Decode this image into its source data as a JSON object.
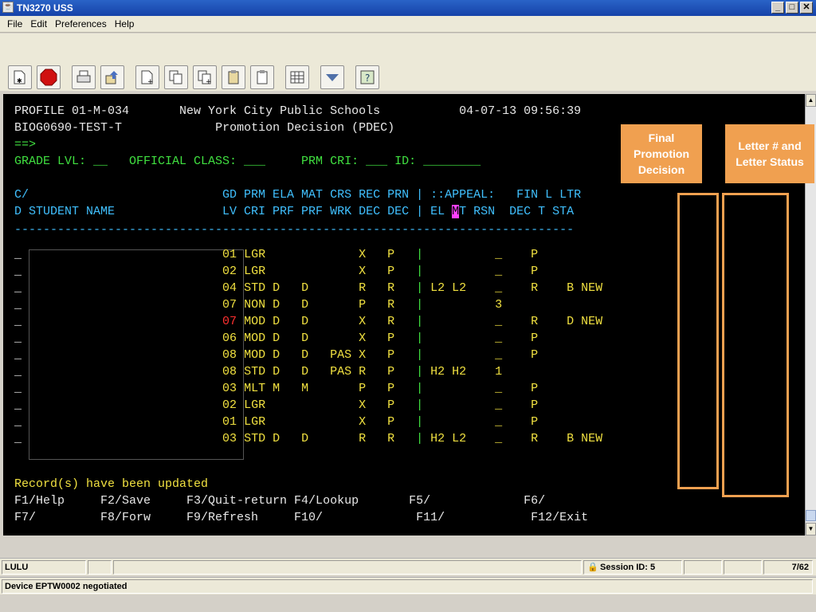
{
  "window": {
    "title": "TN3270  USS",
    "app_icon": "java-cup-icon"
  },
  "menu": [
    "File",
    "Edit",
    "Preferences",
    "Help"
  ],
  "toolbar_icons": [
    "new-session-icon",
    "stop-icon",
    "print-icon",
    "transfer-icon",
    "copy-screen-icon",
    "copy-icon",
    "copy-append-icon",
    "paste-icon",
    "paste-field-icon",
    "grid-icon",
    "dropdown-icon",
    "help-icon"
  ],
  "terminal": {
    "header1_left": "PROFILE 01-M-034",
    "header1_center": "New York City Public Schools",
    "header1_date": "04-07-13 09:56:39",
    "header2_left": "BIOG0690-TEST-T",
    "header2_center": "Promotion Decision (PDEC)",
    "command": "==>",
    "filters": "GRADE LVL: __   OFFICIAL CLASS: ___     PRM CRI: ___ ID: ________",
    "col_head1": "C/                           GD PRM ELA MAT CRS REC PRN | ::APPEAL:   FIN L LTR",
    "col_head2_a": "D STUDENT NAME               LV CRI PRF PRF WRK DEC DEC | EL ",
    "col_head2_cursor": "M",
    "col_head2_b": "T RSN  DEC T STA",
    "divider": "------------------------------------------------------------------------------",
    "rows": [
      {
        "gd": "01",
        "prm": "LGR",
        "ela": "",
        "mat": "",
        "crs": "",
        "rec": "X",
        "prn": "P",
        "el": "",
        "mt": "",
        "rsn": "_",
        "fin": "P",
        "l": "",
        "sta": "",
        "gd_red": false
      },
      {
        "gd": "02",
        "prm": "LGR",
        "ela": "",
        "mat": "",
        "crs": "",
        "rec": "X",
        "prn": "P",
        "el": "",
        "mt": "",
        "rsn": "_",
        "fin": "P",
        "l": "",
        "sta": "",
        "gd_red": false
      },
      {
        "gd": "04",
        "prm": "STD",
        "ela": "D",
        "mat": "D",
        "crs": "",
        "rec": "R",
        "prn": "R",
        "el": "L2",
        "mt": "L2",
        "rsn": "_",
        "fin": "R",
        "l": "B",
        "sta": "NEW",
        "gd_red": false
      },
      {
        "gd": "07",
        "prm": "NON",
        "ela": "D",
        "mat": "D",
        "crs": "",
        "rec": "P",
        "prn": "R",
        "el": "",
        "mt": "",
        "rsn": "3",
        "fin": "",
        "l": "",
        "sta": "",
        "gd_red": false
      },
      {
        "gd": "07",
        "prm": "MOD",
        "ela": "D",
        "mat": "D",
        "crs": "",
        "rec": "X",
        "prn": "R",
        "el": "",
        "mt": "",
        "rsn": "_",
        "fin": "R",
        "l": "D",
        "sta": "NEW",
        "gd_red": true
      },
      {
        "gd": "06",
        "prm": "MOD",
        "ela": "D",
        "mat": "D",
        "crs": "",
        "rec": "X",
        "prn": "P",
        "el": "",
        "mt": "",
        "rsn": "_",
        "fin": "P",
        "l": "",
        "sta": "",
        "gd_red": false
      },
      {
        "gd": "08",
        "prm": "MOD",
        "ela": "D",
        "mat": "D",
        "crs": "PAS",
        "rec": "X",
        "prn": "P",
        "el": "",
        "mt": "",
        "rsn": "_",
        "fin": "P",
        "l": "",
        "sta": "",
        "gd_red": false
      },
      {
        "gd": "08",
        "prm": "STD",
        "ela": "D",
        "mat": "D",
        "crs": "PAS",
        "rec": "R",
        "prn": "P",
        "el": "H2",
        "mt": "H2",
        "rsn": "1",
        "fin": "",
        "l": "",
        "sta": "",
        "gd_red": false
      },
      {
        "gd": "03",
        "prm": "MLT",
        "ela": "M",
        "mat": "M",
        "crs": "",
        "rec": "P",
        "prn": "P",
        "el": "",
        "mt": "",
        "rsn": "_",
        "fin": "P",
        "l": "",
        "sta": "",
        "gd_red": false
      },
      {
        "gd": "02",
        "prm": "LGR",
        "ela": "",
        "mat": "",
        "crs": "",
        "rec": "X",
        "prn": "P",
        "el": "",
        "mt": "",
        "rsn": "_",
        "fin": "P",
        "l": "",
        "sta": "",
        "gd_red": false
      },
      {
        "gd": "01",
        "prm": "LGR",
        "ela": "",
        "mat": "",
        "crs": "",
        "rec": "X",
        "prn": "P",
        "el": "",
        "mt": "",
        "rsn": "_",
        "fin": "P",
        "l": "",
        "sta": "",
        "gd_red": false
      },
      {
        "gd": "03",
        "prm": "STD",
        "ela": "D",
        "mat": "D",
        "crs": "",
        "rec": "R",
        "prn": "R",
        "el": "H2",
        "mt": "L2",
        "rsn": "_",
        "fin": "R",
        "l": "B",
        "sta": "NEW",
        "gd_red": false
      }
    ],
    "message": "Record(s) have been updated",
    "fkeys1": "F1/Help     F2/Save     F3/Quit-return F4/Lookup       F5/             F6/",
    "fkeys2": "F7/         F8/Forw     F9/Refresh     F10/             F11/            F12/Exit"
  },
  "annotations": {
    "final": "Final Promotion Decision",
    "letter": "Letter # and Letter Status"
  },
  "status": {
    "user": "LULU",
    "session": "Session ID: 5",
    "position": "7/62",
    "device": "Device EPTW0002 negotiated"
  },
  "colors": {
    "terminal_bg": "#000000",
    "annotation": "#f0a050"
  }
}
